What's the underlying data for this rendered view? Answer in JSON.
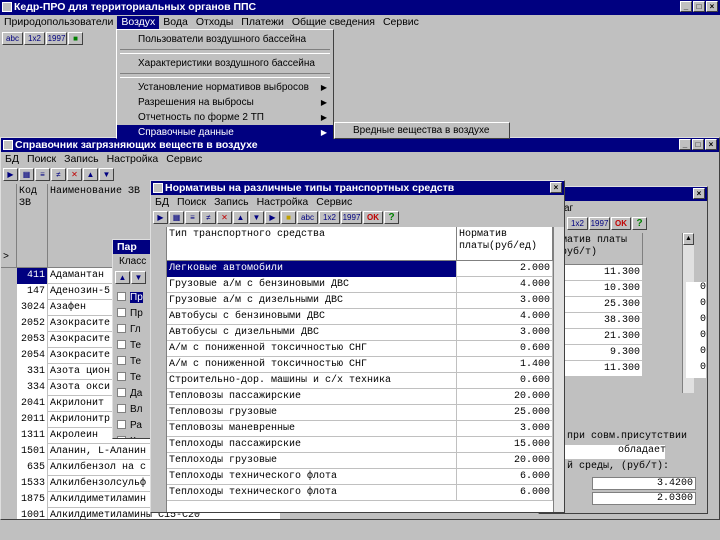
{
  "app": {
    "title": "Кедр-ПРО для территориальных органов ППС",
    "menu": [
      "Природопользователи",
      "Воздух",
      "Вода",
      "Отходы",
      "Платежи",
      "Общие сведения",
      "Сервис"
    ],
    "toolbar": [
      "abc",
      "1x2",
      "1997"
    ]
  },
  "air_menu": {
    "items": [
      "Пользователи воздушного бассейна",
      "Характеристики воздушного бассейна",
      "Установление нормативов выбросов",
      "Разрешения на выбросы",
      "Отчетность по форме 2 ТП",
      "Справочные данные"
    ],
    "submenu": "Вредные вещества в воздухе"
  },
  "pollutants": {
    "title": "Справочник загрязняющих веществ в воздухе",
    "menu": [
      "БД",
      "Поиск",
      "Запись",
      "Настройка",
      "Сервис"
    ],
    "col_code": "Код ЗВ",
    "col_name": "Наименование ЗВ",
    "rows": [
      [
        "411",
        "Адамантан"
      ],
      [
        "147",
        "Аденозин-5"
      ],
      [
        "3024",
        "Азафен"
      ],
      [
        "2052",
        "Азокрасите"
      ],
      [
        "2053",
        "Азокрасите"
      ],
      [
        "2054",
        "Азокрасите"
      ],
      [
        "331",
        "Азота цион"
      ],
      [
        "334",
        "Азота окси"
      ],
      [
        "2041",
        "Акрилонит"
      ],
      [
        "2011",
        "Акрилонитр"
      ],
      [
        "1311",
        "Акролеин"
      ],
      [
        "1501",
        "Аланин, L-Аланин"
      ],
      [
        "635",
        "Алкилбензол на с"
      ],
      [
        "1533",
        "Алкилбензолсульф"
      ],
      [
        "1875",
        "Алкилдиметиламин"
      ],
      [
        "1001",
        "Алкилдиметиламины С15-С20"
      ]
    ],
    "mark": ">"
  },
  "param": {
    "title": "Пар",
    "label": "Класс",
    "items": [
      "Пр",
      "Пр",
      "Гл",
      "Те",
      "Те",
      "Те",
      "Да",
      "Вл",
      "Ра",
      "Ка"
    ]
  },
  "right": {
    "hdr": "рматив платы",
    "sub": "(руб/т)",
    "tab": "аг",
    "values": [
      "11.300",
      "10.300",
      "25.300",
      "38.300",
      "21.300",
      "9.300",
      "11.300"
    ],
    "bottom": [
      "при совм.присутствии",
      "обладает",
      "й среды, (руб/т):"
    ],
    "vals": [
      "3.4200",
      "2.0300"
    ],
    "edge": [
      "0",
      "0",
      "0",
      "0",
      "0",
      "0"
    ]
  },
  "norms": {
    "title": "Нормативы на различные типы транспортных средств",
    "menu": [
      "БД",
      "Поиск",
      "Запись",
      "Настройка",
      "Сервис"
    ],
    "col_type": "Тип транспортного средства",
    "col_norm": "Норматив платы(руб/ед)",
    "rows": [
      [
        "Легковые автомобили",
        "2.000"
      ],
      [
        "Грузовые а/м с бензиновыми ДВС",
        "4.000"
      ],
      [
        "Грузовые а/м с дизельными ДВС",
        "3.000"
      ],
      [
        "Автобусы с бензиновыми ДВС",
        "4.000"
      ],
      [
        "Автобусы с дизельными ДВС",
        "3.000"
      ],
      [
        "А/м с пониженной токсичностью СНГ",
        "0.600"
      ],
      [
        "А/м с пониженной токсичностью СНГ",
        "1.400"
      ],
      [
        "Строительно-дор. машины и с/х техника",
        "0.600"
      ],
      [
        "Тепловозы пассажирские",
        "20.000"
      ],
      [
        "Тепловозы грузовые",
        "25.000"
      ],
      [
        "Тепловозы маневренные",
        "3.000"
      ],
      [
        "Теплоходы пассажирские",
        "15.000"
      ],
      [
        "Теплоходы грузовые",
        "20.000"
      ],
      [
        "Теплоходы технического флота",
        "6.000"
      ],
      [
        "Теплоходы технического флота",
        "6.000"
      ]
    ]
  },
  "colors": {
    "title": "#000080",
    "chrome": "#c0c0c0"
  }
}
